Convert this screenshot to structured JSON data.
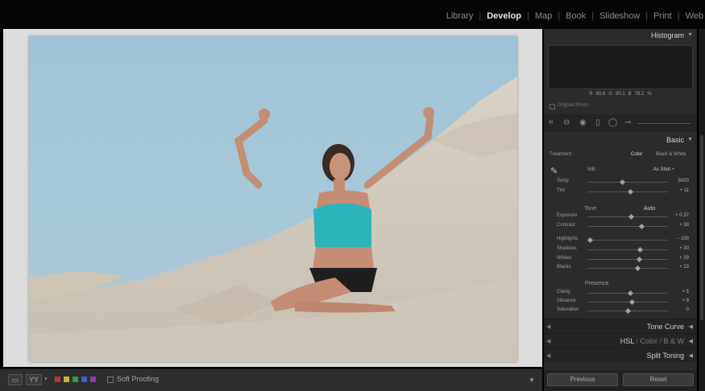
{
  "modules": [
    "Library",
    "Develop",
    "Map",
    "Book",
    "Slideshow",
    "Print",
    "Web"
  ],
  "active_module": "Develop",
  "histogram": {
    "title": "Histogram",
    "r_label": "R",
    "r_value": "80.6",
    "g_label": "G",
    "g_value": "80.1",
    "b_label": "B",
    "b_value": "78.2",
    "percent": "%",
    "original_photo": "Original Photo"
  },
  "basic": {
    "title": "Basic",
    "treatment_label": "Treatment :",
    "color_option": "Color",
    "bw_option": "Black & White",
    "wb_label": "WB :",
    "wb_value": "As Shot ÷",
    "tone_label": "Tone",
    "auto_label": "Auto",
    "presence_label": "Presence",
    "sliders": [
      {
        "label": "Temp",
        "value": "5000",
        "pos": 0.43
      },
      {
        "label": "Tint",
        "value": "+ 11",
        "pos": 0.53
      },
      {
        "label": "Exposure",
        "value": "+ 0.37",
        "pos": 0.54
      },
      {
        "label": "Contrast",
        "value": "+ 38",
        "pos": 0.67
      },
      {
        "label": "Highlights",
        "value": "− 100",
        "pos": 0.03
      },
      {
        "label": "Shadows",
        "value": "+ 30",
        "pos": 0.65
      },
      {
        "label": "Whites",
        "value": "+ 29",
        "pos": 0.64
      },
      {
        "label": "Blacks",
        "value": "+ 23",
        "pos": 0.62
      },
      {
        "label": "Clarity",
        "value": "+ 5",
        "pos": 0.53
      },
      {
        "label": "Vibrance",
        "value": "+ 9",
        "pos": 0.55
      },
      {
        "label": "Saturation",
        "value": "0",
        "pos": 0.5
      }
    ]
  },
  "collapsed_panels": {
    "tone_curve": "Tone Curve",
    "hsl": "HSL",
    "color": "Color",
    "bw": "B & W",
    "split_toning": "Split Toning"
  },
  "buttons": {
    "previous": "Previous",
    "reset": "Reset"
  },
  "toolbar": {
    "view_icon": "▭",
    "ratio_icon": "YY",
    "soft_proofing": "Soft Proofing"
  },
  "colors": {
    "swatch_red": "#c83232",
    "swatch_yellow": "#c8b432",
    "swatch_green": "#3c9c3c",
    "swatch_blue": "#3c64c8",
    "swatch_purple": "#8c3cb4"
  }
}
